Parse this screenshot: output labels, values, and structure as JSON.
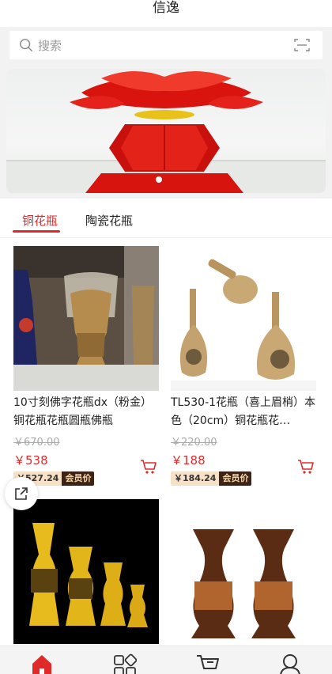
{
  "app": {
    "title": "信逸"
  },
  "search": {
    "placeholder": "搜索",
    "search_icon": "search-icon",
    "scan_icon": "scan-icon"
  },
  "banner": {
    "active_slide": 1,
    "slide_count": 1
  },
  "tabs": [
    {
      "label": "铜花瓶",
      "active": true
    },
    {
      "label": "陶瓷花瓶",
      "active": false
    }
  ],
  "products": [
    {
      "name": "10寸刻佛字花瓶dx（粉金） 铜花瓶花瓶圆瓶佛瓶",
      "original_price": "￥670.00",
      "price": "￥538",
      "member_price": "￥527.24",
      "member_label": "会员价"
    },
    {
      "name": "TL530-1花瓶（喜上眉梢）本色（20cm）铜花瓶花…",
      "original_price": "￥220.00",
      "price": "￥188",
      "member_price": "￥184.24",
      "member_label": "会员价"
    },
    {
      "name": "",
      "original_price": "",
      "price": "",
      "member_price": "",
      "member_label": ""
    },
    {
      "name": "",
      "original_price": "",
      "price": "",
      "member_price": "",
      "member_label": ""
    }
  ],
  "tabbar": {
    "items": [
      "home-icon",
      "category-icon",
      "cart-icon",
      "profile-icon"
    ],
    "active_index": 0
  },
  "colors": {
    "accent": "#e02a2a",
    "member_bg": "#f7e1c6",
    "member_label_bg": "#3c2316"
  }
}
